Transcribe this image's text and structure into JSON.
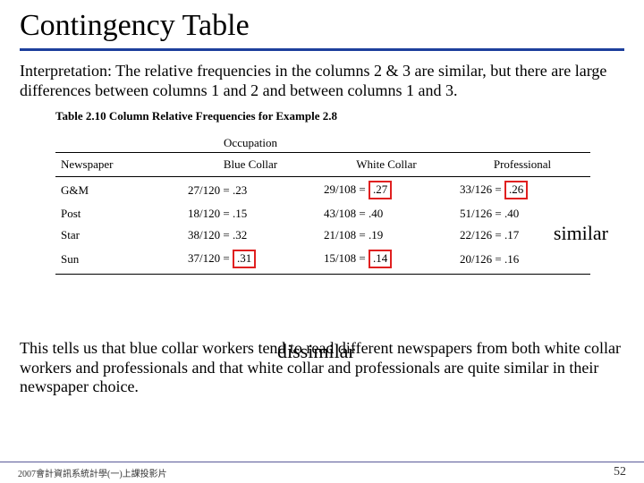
{
  "title": "Contingency Table",
  "intro": "Interpretation: The relative frequencies in the columns 2 & 3 are similar, but there are large differences between columns 1 and 2 and between columns 1 and 3.",
  "table": {
    "caption": "Table 2.10 Column Relative Frequencies for Example 2.8",
    "topHeader": "Occupation",
    "colHeaders": [
      "Newspaper",
      "Blue Collar",
      "White Collar",
      "Professional"
    ],
    "rows": [
      {
        "label": "G&M",
        "c1": "27/120 = .23",
        "c2pre": "29/108 = ",
        "c2box": ".27",
        "c3pre": "33/126 = ",
        "c3box": ".26"
      },
      {
        "label": "Post",
        "c1": "18/120 = .15",
        "c2": "43/108 = .40",
        "c3": "51/126 = .40"
      },
      {
        "label": "Star",
        "c1": "38/120 = .32",
        "c2": "21/108 = .19",
        "c3": "22/126 = .17"
      },
      {
        "label": "Sun",
        "c1pre": "37/120 = ",
        "c1box": ".31",
        "c2pre": "15/108 = ",
        "c2box": ".14",
        "c3": "20/126 = .16"
      }
    ]
  },
  "annot": {
    "similar": "similar",
    "dissimilar": "dissimilar"
  },
  "conclusion": "This tells us that blue collar workers tend to read different newspapers from both white collar workers and professionals and that white collar and professionals are quite similar in their newspaper choice.",
  "footer": {
    "left": "2007會計資訊系統計學(一)上課投影片",
    "page": "52"
  }
}
